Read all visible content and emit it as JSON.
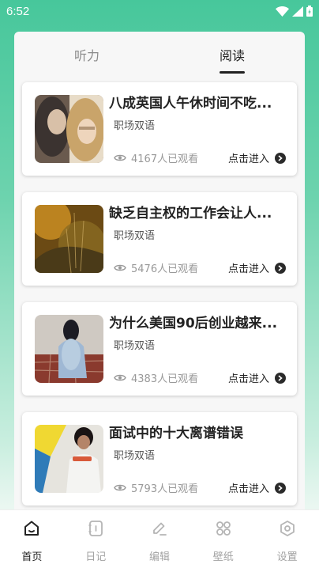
{
  "status_bar": {
    "time": "6:52"
  },
  "tabs": [
    {
      "label": "听力",
      "active": false
    },
    {
      "label": "阅读",
      "active": true
    }
  ],
  "articles": [
    {
      "title": "八成英国人午休时间不吃...",
      "category": "职场双语",
      "views": "4167人已观看",
      "action": "点击进入"
    },
    {
      "title": "缺乏自主权的工作会让人...",
      "category": "职场双语",
      "views": "5476人已观看",
      "action": "点击进入"
    },
    {
      "title": "为什么美国90后创业越来...",
      "category": "职场双语",
      "views": "4383人已观看",
      "action": "点击进入"
    },
    {
      "title": "面试中的十大离谱错误",
      "category": "职场双语",
      "views": "5793人已观看",
      "action": "点击进入"
    }
  ],
  "bottom_nav": [
    {
      "label": "首页",
      "icon": "home-icon",
      "active": true
    },
    {
      "label": "日记",
      "icon": "diary-icon",
      "active": false
    },
    {
      "label": "编辑",
      "icon": "edit-icon",
      "active": false
    },
    {
      "label": "壁纸",
      "icon": "wallpaper-icon",
      "active": false
    },
    {
      "label": "设置",
      "icon": "settings-icon",
      "active": false
    }
  ],
  "colors": {
    "accent_green": "#47c79b",
    "active_text": "#222222",
    "inactive_text": "#a3a3a3"
  }
}
